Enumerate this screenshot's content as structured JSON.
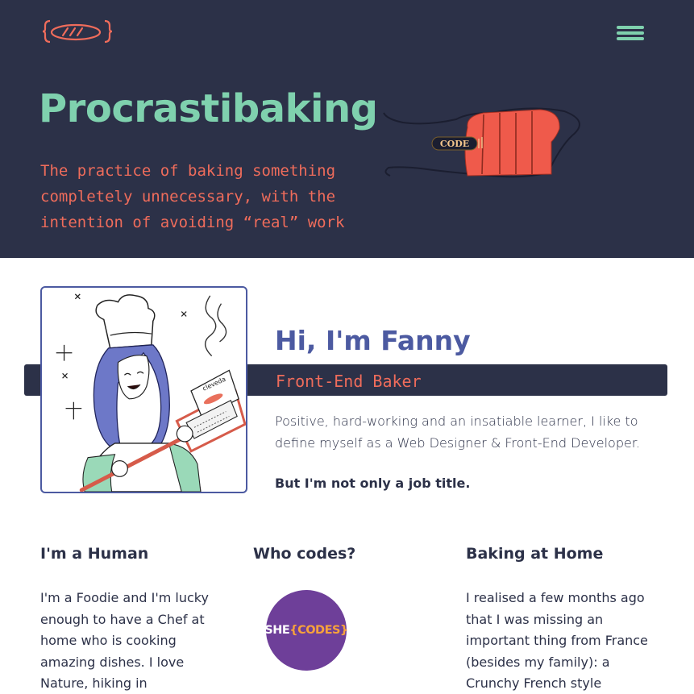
{
  "header": {
    "logo_icon": "bread-braces-logo-icon",
    "menu_icon": "hamburger-menu-icon",
    "title": "Procrastibaking",
    "subtitle": "The practice of baking something\ncompletely unnecessary, with the\nintention of avoiding “real” work",
    "illustration_label": "CODE"
  },
  "intro": {
    "portrait_icon": "chef-portrait-illustration",
    "greeting": "Hi, I'm Fanny",
    "role": "Front-End Baker",
    "description": "Positive, hard-working and an insatiable learner, I like to define myself as a Web Designer & Front-End Developer.",
    "bold_line": "But I'm not only a job title."
  },
  "sections": [
    {
      "title": "I'm a Human",
      "text": "I'm a Foodie and I'm lucky enough to have a Chef at home who is cooking amazing dishes. I love Nature, hiking in"
    },
    {
      "title": "Who codes?",
      "logo_text_a": "SHE",
      "logo_text_b": "{CODES}"
    },
    {
      "title": "Baking at Home",
      "text": "I realised a few months ago that I was missing an important thing from France (besides my family): a Crunchy French style"
    }
  ],
  "colors": {
    "navy": "#2c3148",
    "mint": "#7fd1ae",
    "coral": "#ef6c5b",
    "indigo": "#4c5aa1",
    "purple": "#6e3f99",
    "orange": "#f7a23b"
  }
}
